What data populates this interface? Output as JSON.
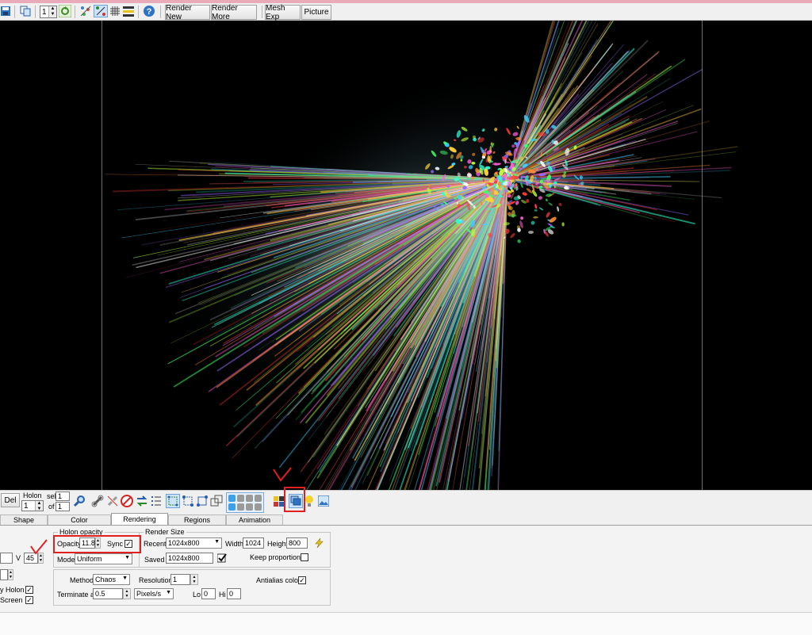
{
  "toolbar": {
    "frame_value": "1",
    "render_new_label": "Render New",
    "render_more_label": "Render More",
    "mesh_exp_label": "Mesh Exp",
    "picture_label": "Picture"
  },
  "holon_bar": {
    "del_label": "Del",
    "holon_label": "Holon",
    "holon_value": "1",
    "sel_label": "sel",
    "sel_value": "1",
    "of_label": "of",
    "of_value": "1"
  },
  "tabs": [
    {
      "label": "Shape",
      "active": false
    },
    {
      "label": "Color",
      "active": false
    },
    {
      "label": "Rendering",
      "active": true
    },
    {
      "label": "Regions",
      "active": false
    },
    {
      "label": "Animation",
      "active": false
    }
  ],
  "left_partial": {
    "v_label": "V",
    "v_value": "45",
    "holon_check_label": "y Holon",
    "screen_check_label": "Screen"
  },
  "holon_opacity": {
    "group_label": "Holon opacity",
    "opacity_label": "Opacity",
    "opacity_value": "11.8",
    "sync_label": "Sync",
    "sync_checked": true,
    "mode_label": "Mode",
    "mode_value": "Uniform"
  },
  "render_size": {
    "group_label": "Render Size",
    "recent_label": "Recent",
    "recent_value": "1024x800",
    "width_label": "Width",
    "width_value": "1024",
    "height_label": "Height",
    "height_value": "800",
    "saved_label": "Saved",
    "saved_value": "1024x800",
    "keep_proportions_label": "Keep proportions",
    "keep_proportions_checked": false
  },
  "render_settings": {
    "method_label": "Method",
    "method_value": "Chaos",
    "resolution_label": "Resolution",
    "resolution_value": "1",
    "antialias_label": "Antialias color",
    "antialias_checked": true,
    "terminate_label": "Terminate at",
    "terminate_value": "0.5",
    "units_value": "Pixels/s",
    "lo_label": "Lo",
    "lo_value": "0",
    "hi_label": "Hi",
    "hi_value": "0"
  },
  "colors": {
    "accent_red": "#e02020",
    "titlebar": "#e9aab9"
  }
}
